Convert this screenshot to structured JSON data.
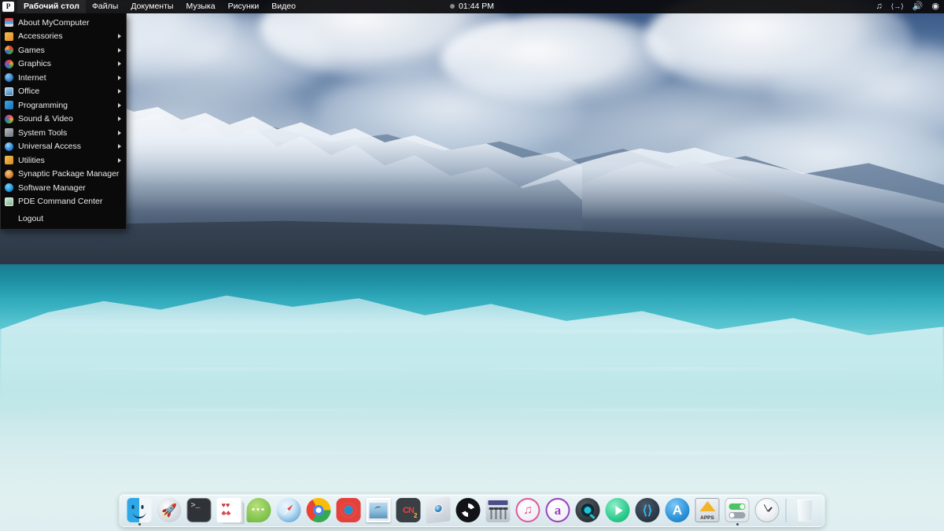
{
  "menubar": {
    "logo": "P",
    "items": [
      {
        "label": "Рабочий стол",
        "active": true
      },
      {
        "label": "Файлы",
        "active": false
      },
      {
        "label": "Документы",
        "active": false
      },
      {
        "label": "Музыка",
        "active": false
      },
      {
        "label": "Рисунки",
        "active": false
      },
      {
        "label": "Видео",
        "active": false
      }
    ],
    "clock": "01:44 PM",
    "status_icons": [
      {
        "name": "music-note-icon",
        "glyph": "♫"
      },
      {
        "name": "slider-icon",
        "glyph": "⟨→⟩"
      },
      {
        "name": "volume-icon",
        "glyph": "🔊"
      },
      {
        "name": "settings-icon",
        "glyph": "◉"
      }
    ]
  },
  "appmenu": {
    "items": [
      {
        "label": "About MyComputer",
        "icon": "about-icon",
        "icon_class": "ic-about",
        "submenu": false
      },
      {
        "label": "Accessories",
        "icon": "accessories-icon",
        "icon_class": "ic-accessories",
        "submenu": true
      },
      {
        "label": "Games",
        "icon": "games-icon",
        "icon_class": "ic-games",
        "submenu": true
      },
      {
        "label": "Graphics",
        "icon": "graphics-icon",
        "icon_class": "ic-graphics",
        "submenu": true
      },
      {
        "label": "Internet",
        "icon": "internet-icon",
        "icon_class": "ic-internet",
        "submenu": true
      },
      {
        "label": "Office",
        "icon": "office-icon",
        "icon_class": "ic-office",
        "submenu": true
      },
      {
        "label": "Programming",
        "icon": "programming-icon",
        "icon_class": "ic-programming",
        "submenu": true
      },
      {
        "label": "Sound & Video",
        "icon": "sound-video-icon",
        "icon_class": "ic-sound",
        "submenu": true
      },
      {
        "label": "System Tools",
        "icon": "system-tools-icon",
        "icon_class": "ic-systemtools",
        "submenu": true
      },
      {
        "label": "Universal Access",
        "icon": "universal-access-icon",
        "icon_class": "ic-universal",
        "submenu": true
      },
      {
        "label": "Utilities",
        "icon": "utilities-icon",
        "icon_class": "ic-utilities",
        "submenu": true
      },
      {
        "label": "Synaptic Package Manager",
        "icon": "synaptic-icon",
        "icon_class": "ic-synaptic",
        "submenu": false
      },
      {
        "label": "Software Manager",
        "icon": "software-manager-icon",
        "icon_class": "ic-software",
        "submenu": false
      },
      {
        "label": "PDE Command Center",
        "icon": "pde-command-center-icon",
        "icon_class": "ic-pde",
        "submenu": false
      },
      {
        "label": "Logout",
        "icon": "",
        "icon_class": "blank",
        "submenu": false
      }
    ]
  },
  "dock": {
    "items": [
      {
        "name": "finder",
        "label": "Finder"
      },
      {
        "name": "launchpad",
        "label": "Launchpad"
      },
      {
        "name": "terminal",
        "label": "Terminal"
      },
      {
        "name": "cards",
        "label": "Cards"
      },
      {
        "name": "messages",
        "label": "Messages"
      },
      {
        "name": "safari",
        "label": "Safari"
      },
      {
        "name": "chrome",
        "label": "Google Chrome"
      },
      {
        "name": "opera",
        "label": "Opera"
      },
      {
        "name": "photos",
        "label": "Photos"
      },
      {
        "name": "cn-app",
        "label": "CN"
      },
      {
        "name": "screenshot",
        "label": "Screenshot"
      },
      {
        "name": "obs",
        "label": "OBS"
      },
      {
        "name": "mixer",
        "label": "Mixer"
      },
      {
        "name": "itunes",
        "label": "iTunes"
      },
      {
        "name": "amazon",
        "label": "Amazon"
      },
      {
        "name": "quicktime",
        "label": "QuickTime"
      },
      {
        "name": "media-player",
        "label": "Media Player"
      },
      {
        "name": "kodi",
        "label": "Kodi"
      },
      {
        "name": "app-store",
        "label": "App Store"
      },
      {
        "name": "apps-folder",
        "label": "APPS"
      },
      {
        "name": "system-settings",
        "label": "Settings"
      },
      {
        "name": "clock",
        "label": "Clock"
      },
      {
        "name": "trash",
        "label": "Trash"
      }
    ],
    "apps_icon_label": "APPS",
    "terminal_prompt": ">_"
  },
  "wallpaper": {
    "description": "Snow-capped mountain range reflected in a turquoise glacial lake under a cloudy sky",
    "sky_color": "#6c87ab",
    "lake_color": "#55c3cf",
    "mountain_color": "#51637a"
  }
}
